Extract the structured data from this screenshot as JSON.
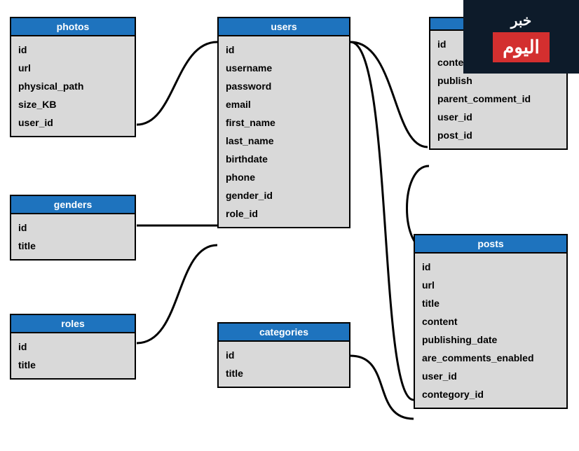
{
  "tables": {
    "photos": {
      "title": "photos",
      "fields": [
        "id",
        "url",
        "physical_path",
        "size_KB",
        "user_id"
      ]
    },
    "genders": {
      "title": "genders",
      "fields": [
        "id",
        "title"
      ]
    },
    "roles": {
      "title": "roles",
      "fields": [
        "id",
        "title"
      ]
    },
    "users": {
      "title": "users",
      "fields": [
        "id",
        "username",
        "password",
        "email",
        "first_name",
        "last_name",
        "birthdate",
        "phone",
        "gender_id",
        "role_id"
      ]
    },
    "categories": {
      "title": "categories",
      "fields": [
        "id",
        "title"
      ]
    },
    "comments": {
      "title": "",
      "fields": [
        "id",
        "conten",
        "publish",
        "parent_comment_id",
        "user_id",
        "post_id"
      ]
    },
    "posts": {
      "title": "posts",
      "fields": [
        "id",
        "url",
        "title",
        "content",
        "publishing_date",
        "are_comments_enabled",
        "user_id",
        "contegory_id"
      ]
    }
  },
  "logo": {
    "line1": "خبر",
    "line2": "اليوم"
  }
}
